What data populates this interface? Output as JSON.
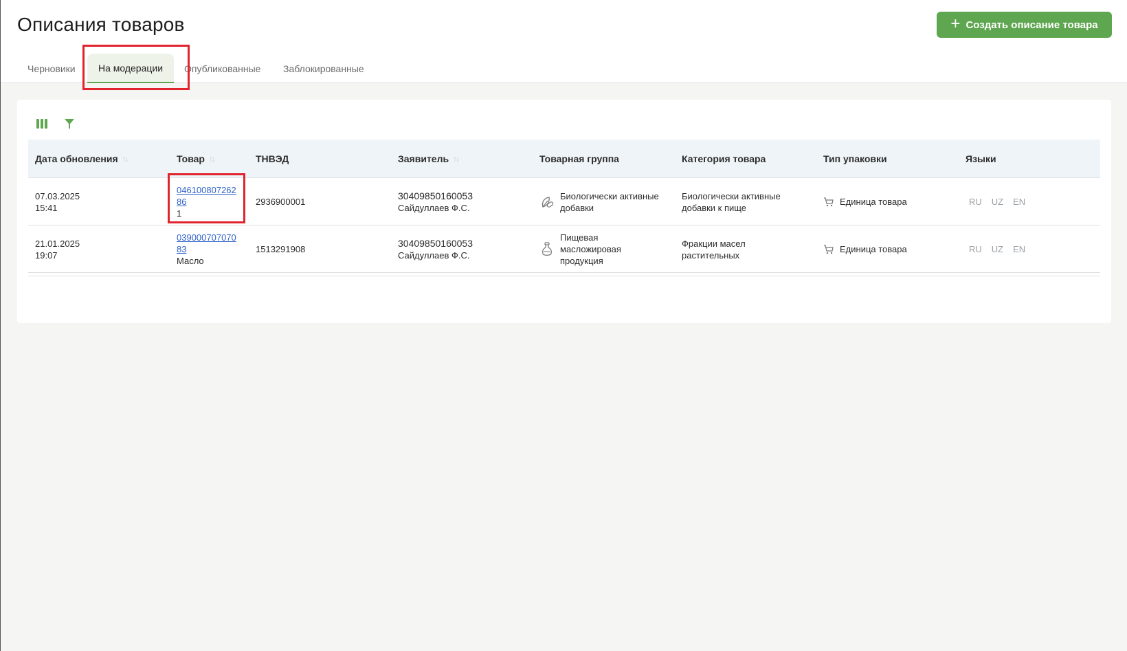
{
  "page": {
    "title": "Описания товаров"
  },
  "actions": {
    "create_label": "Создать описание товара"
  },
  "tabs": [
    {
      "label": "Черновики"
    },
    {
      "label": "На модерации"
    },
    {
      "label": "Опубликованные"
    },
    {
      "label": "Заблокированные"
    }
  ],
  "toolbar": {
    "columns_icon": "columns-icon",
    "filter_icon": "filter-icon"
  },
  "table": {
    "headers": {
      "date": "Дата обновления",
      "product": "Товар",
      "tnved": "ТНВЭД",
      "applicant": "Заявитель",
      "group": "Товарная группа",
      "category": "Категория товара",
      "packaging": "Тип упаковки",
      "languages": "Языки"
    },
    "rows": [
      {
        "date": "07.03.2025",
        "time": "15:41",
        "code_part1": "046100807262",
        "code_part2": "86",
        "name": "1",
        "tnved": "2936900001",
        "applicant_id": "30409850160053",
        "applicant_name": "Сайдуллаев Ф.С.",
        "group": "Биологически активные добавки",
        "group_icon": "leaf-pill-icon",
        "category": "Биологически активные добавки к пище",
        "packaging": "Единица товара",
        "langs": [
          "RU",
          "UZ",
          "EN"
        ]
      },
      {
        "date": "21.01.2025",
        "time": "19:07",
        "code_part1": "039000707070",
        "code_part2": "83",
        "name": "Масло",
        "tnved": "1513291908",
        "applicant_id": "30409850160053",
        "applicant_name": "Сайдуллаев Ф.С.",
        "group": "Пищевая масложировая продукция",
        "group_icon": "oil-bottle-icon",
        "category": "Фракции масел растительных",
        "packaging": "Единица товара",
        "langs": [
          "RU",
          "UZ",
          "EN"
        ]
      }
    ]
  },
  "colors": {
    "accent": "#5ea64f",
    "highlight": "#e0232d",
    "link": "#2f62c9"
  }
}
